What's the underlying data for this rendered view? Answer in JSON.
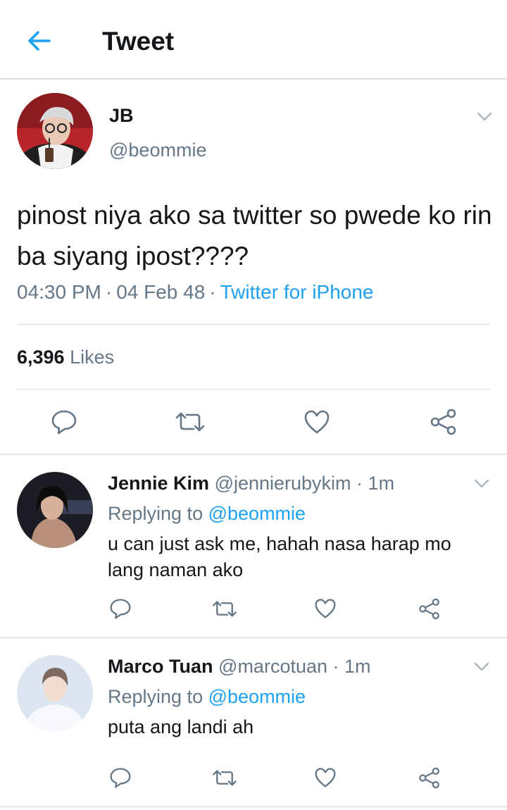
{
  "header": {
    "title": "Tweet"
  },
  "tweet": {
    "name": "JB",
    "handle": "@beommie",
    "text": "pinost niya ako sa twitter so pwede ko rin ba siyang ipost????",
    "time": "04:30 PM",
    "date": "04 Feb 48",
    "source": "Twitter for iPhone",
    "likes_count": "6,396",
    "likes_label": "Likes"
  },
  "replies": [
    {
      "name": "Jennie Kim",
      "handle": "@jennierubykim",
      "time": "1m",
      "replying_label": "Replying to",
      "replying_to": "@beommie",
      "text": "u can just ask me, hahah nasa harap mo lang naman ako"
    },
    {
      "name": "Marco Tuan",
      "handle": "@marcotuan",
      "time": "1m",
      "replying_label": "Replying to",
      "replying_to": "@beommie",
      "text": "puta ang landi ah"
    }
  ],
  "icons": {
    "back": "arrow-left-icon",
    "more": "chevron-down-icon",
    "reply": "reply-icon",
    "retweet": "retweet-icon",
    "like": "heart-icon",
    "share": "share-icon"
  },
  "colors": {
    "accent": "#1da1f2",
    "secondary_text": "#657786",
    "icon": "#657786",
    "divider": "#e1e8ed"
  }
}
